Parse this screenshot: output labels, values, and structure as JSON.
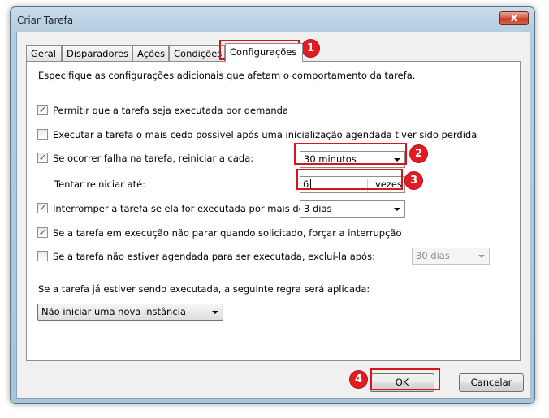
{
  "window": {
    "title": "Criar Tarefa",
    "close_glyph": "x"
  },
  "tabs": [
    {
      "label": "Geral"
    },
    {
      "label": "Disparadores"
    },
    {
      "label": "Ações"
    },
    {
      "label": "Condições"
    },
    {
      "label": "Configurações",
      "active": true
    }
  ],
  "settings": {
    "description": "Especifique as configurações adicionais que afetam o comportamento da tarefa.",
    "allow_on_demand": {
      "checked": true,
      "label": "Permitir que a tarefa seja executada por demanda"
    },
    "run_asap": {
      "checked": false,
      "label": "Executar a tarefa o mais cedo possível após uma inicialização agendada tiver sido perdida"
    },
    "restart_on_fail": {
      "checked": true,
      "label": "Se ocorrer falha na tarefa, reiniciar a cada:",
      "value": "30 minutos"
    },
    "restart_attempts": {
      "label": "Tentar reiniciar até:",
      "value": "6",
      "unit": "vezes"
    },
    "stop_if_longer": {
      "checked": true,
      "label": "Interromper a tarefa se ela for executada por mais de:",
      "value": "3 dias"
    },
    "force_stop": {
      "checked": true,
      "label": "Se a tarefa em execução não parar quando solicitado, forçar a interrupção"
    },
    "delete_after": {
      "checked": false,
      "label": "Se a tarefa não estiver agendada para ser executada, excluí-la após:",
      "value": "30 dias"
    },
    "rule_label": "Se a tarefa já estiver sendo executada, a seguinte regra será aplicada:",
    "rule_value": "Não iniciar uma nova instância"
  },
  "buttons": {
    "ok": "OK",
    "cancel": "Cancelar"
  },
  "annotations": [
    "1",
    "2",
    "3",
    "4"
  ],
  "check_glyph": "✓",
  "colors": {
    "annotation_red": "#e31c24"
  }
}
